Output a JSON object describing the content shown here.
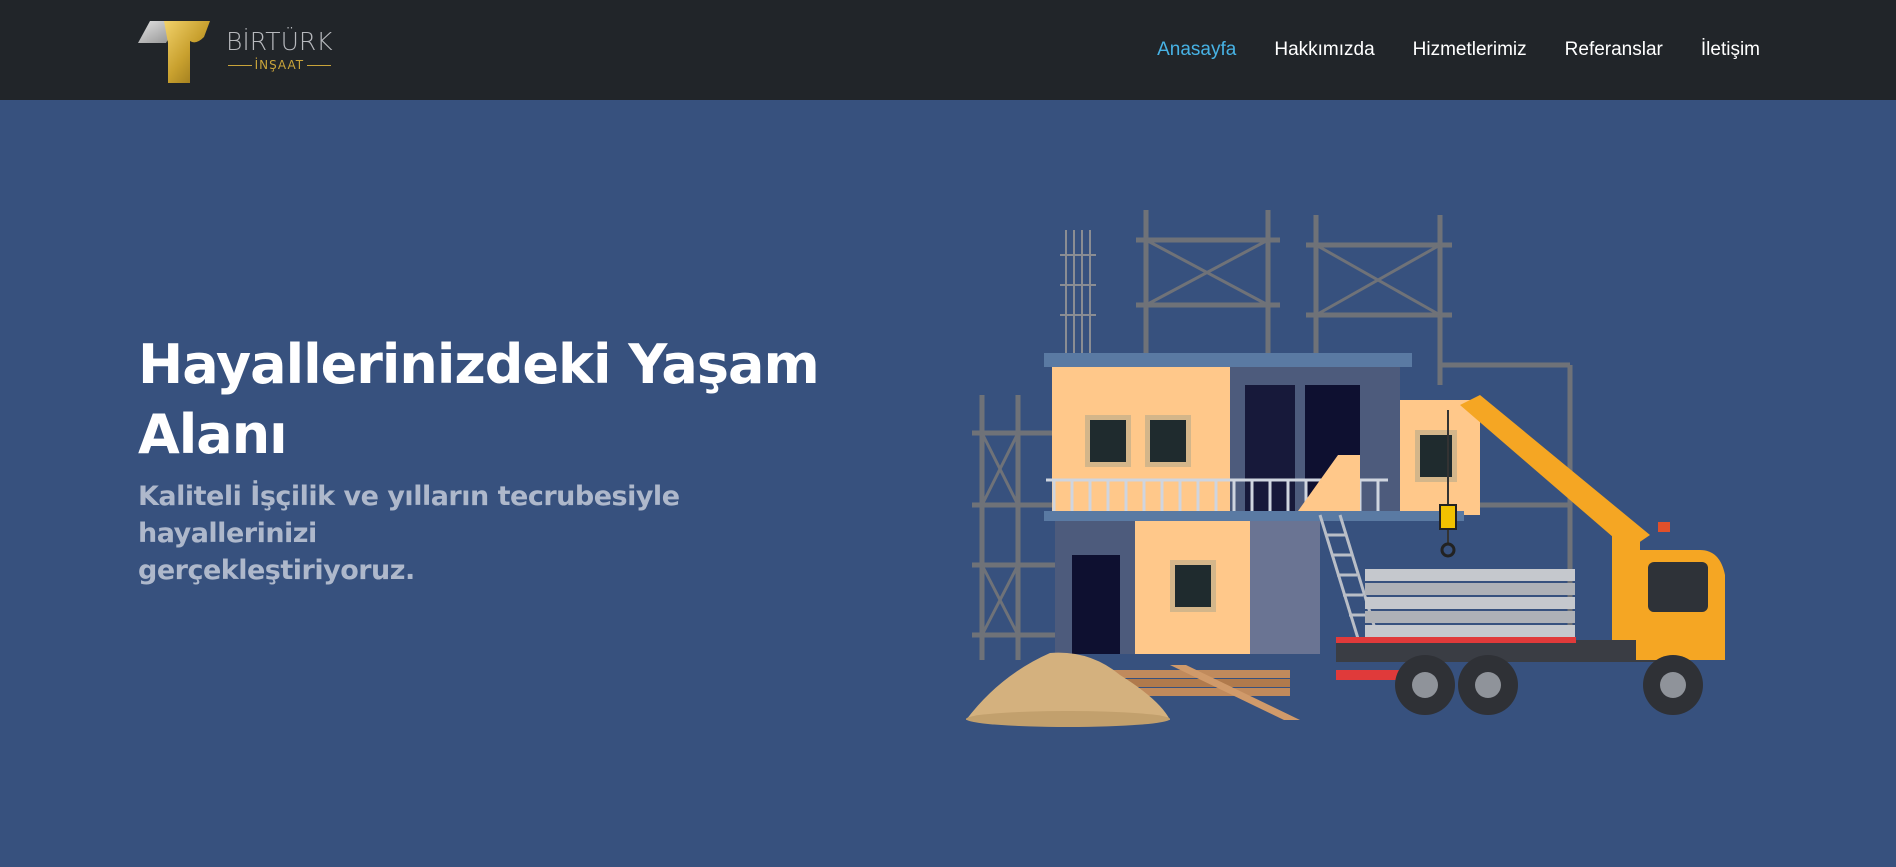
{
  "brand": {
    "name": "BİRTÜRK",
    "sub": "İNŞAAT",
    "gold": "#c9a43a"
  },
  "nav": {
    "items": [
      {
        "label": "Anasayfa",
        "active": true
      },
      {
        "label": "Hakkımızda",
        "active": false
      },
      {
        "label": "Hizmetlerimiz",
        "active": false
      },
      {
        "label": "Referanslar",
        "active": false
      },
      {
        "label": "İletişim",
        "active": false
      }
    ],
    "active_color": "#47b2e4"
  },
  "hero": {
    "title_line1": "Hayallerinizdeki Yaşam",
    "title_line2": "Alanı",
    "subtitle_line1": "Kaliteli İşçilik ve yılların tecrubesiyle hayallerinizi",
    "subtitle_line2": "gerçekleştiriyoruz.",
    "background": "#37517e"
  },
  "illustration": {
    "icon": "construction-site-illustration"
  }
}
